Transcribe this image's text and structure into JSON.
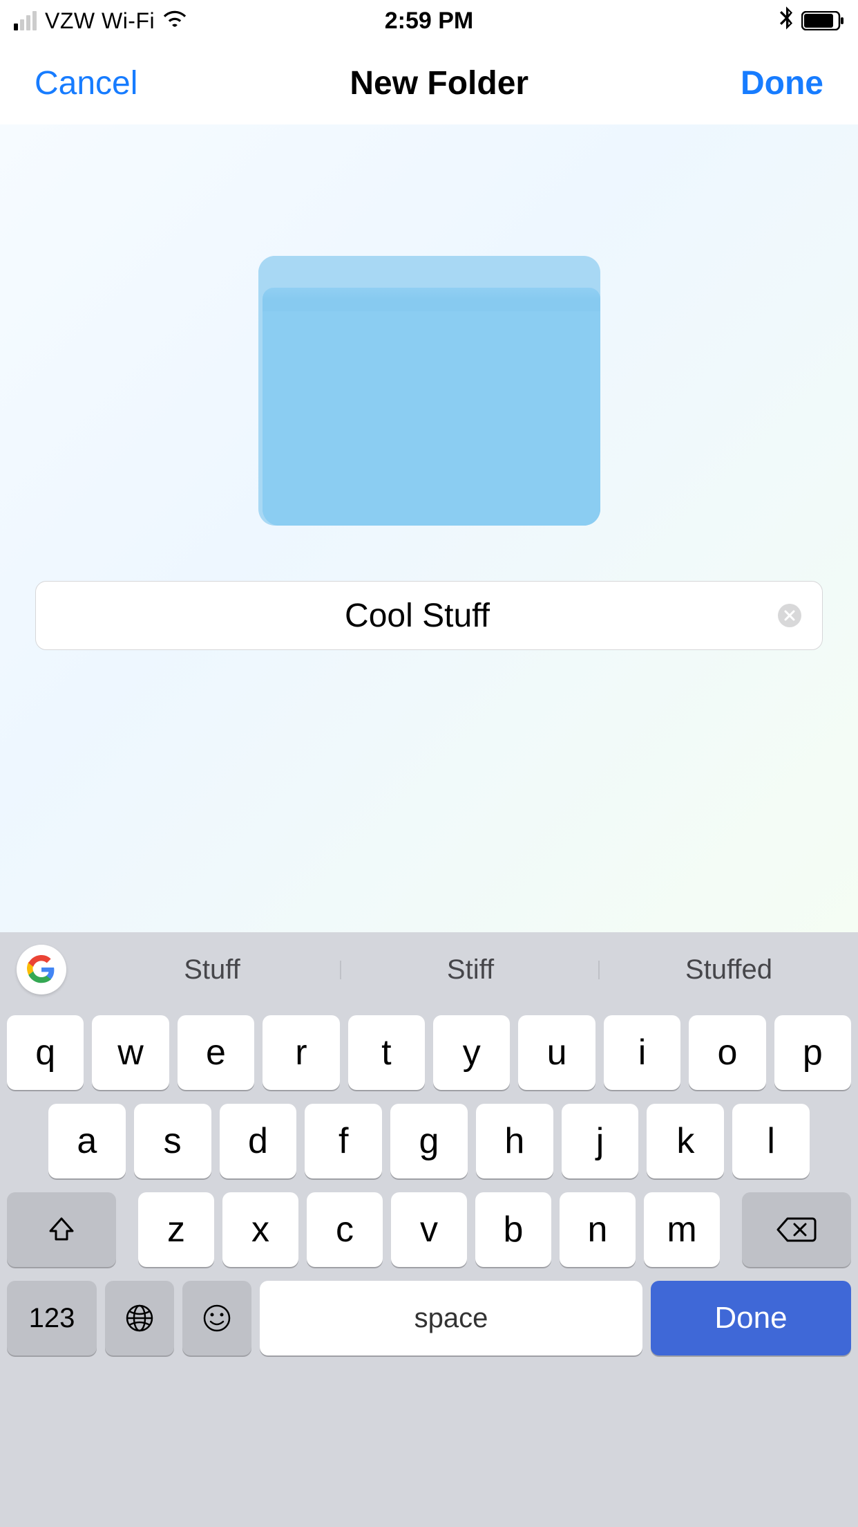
{
  "status_bar": {
    "carrier": "VZW Wi-Fi",
    "time": "2:59 PM"
  },
  "nav": {
    "cancel": "Cancel",
    "title": "New Folder",
    "done": "Done"
  },
  "input": {
    "value": "Cool Stuff"
  },
  "keyboard": {
    "suggestions": [
      "Stuff",
      "Stiff",
      "Stuffed"
    ],
    "row1": [
      "q",
      "w",
      "e",
      "r",
      "t",
      "y",
      "u",
      "i",
      "o",
      "p"
    ],
    "row2": [
      "a",
      "s",
      "d",
      "f",
      "g",
      "h",
      "j",
      "k",
      "l"
    ],
    "row3": [
      "z",
      "x",
      "c",
      "v",
      "b",
      "n",
      "m"
    ],
    "numeric_label": "123",
    "space_label": "space",
    "done_label": "Done"
  }
}
